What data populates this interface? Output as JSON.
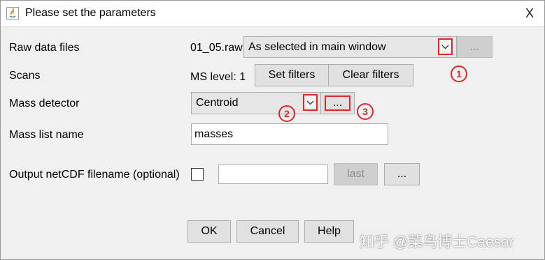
{
  "window": {
    "title": "Please set the parameters",
    "close_label": "X"
  },
  "raw_data": {
    "label": "Raw data files",
    "file_name": "01_05.raw",
    "selection": "As selected in main window",
    "more_label": "..."
  },
  "scans": {
    "label": "Scans",
    "ms_level": "MS level: 1",
    "set_filters_label": "Set filters",
    "clear_filters_label": "Clear filters"
  },
  "mass_detector": {
    "label": "Mass detector",
    "selection": "Centroid",
    "settings_label": "..."
  },
  "mass_list": {
    "label": "Mass list name",
    "value": "masses"
  },
  "output": {
    "label": "Output netCDF filename (optional)",
    "filename_value": "",
    "checked": false,
    "last_label": "last",
    "browse_label": "..."
  },
  "footer": {
    "ok_label": "OK",
    "cancel_label": "Cancel",
    "help_label": "Help"
  },
  "annotations": {
    "marker_1": "1",
    "marker_2": "2",
    "marker_3": "3",
    "color": "#d8282a"
  },
  "watermark": "知乎 @菜鸟博士Caesar"
}
